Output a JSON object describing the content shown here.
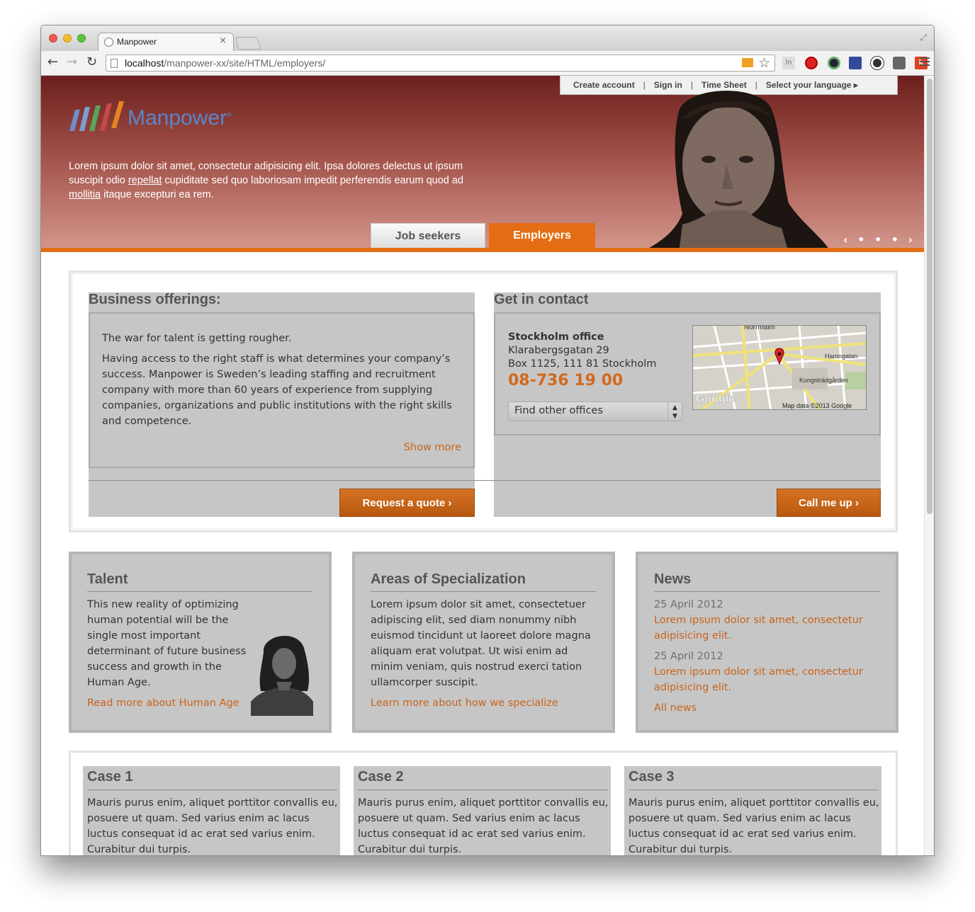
{
  "browser": {
    "tab_title": "Manpower",
    "tab_close": "×",
    "url_host": "localhost",
    "url_path": "/manpower-xx/site/HTML/employers/",
    "extension_k": "k",
    "extension_in": "In",
    "colors": {
      "close": "#ee5a53",
      "minimize": "#f3bb2e",
      "maximize": "#5fc23e"
    }
  },
  "header": {
    "top_nav": [
      "Create account",
      "Sign in",
      "Time Sheet",
      "Select your language ▸"
    ],
    "logo_text": "Manpower",
    "logo_mark": "®",
    "intro_before_link1": "Lorem ipsum dolor sit amet, consectetur adipisicing elit. Ipsa dolores delectus ut ipsum suscipit odio ",
    "intro_link1": "repellat",
    "intro_after_link1": " cupiditate sed quo laboriosam impedit perferendis earum quod ad ",
    "intro_link2": "mollitia",
    "intro_after_link2": " itaque excepturi ea rem.",
    "tabs": {
      "job_seekers": "Job seekers",
      "employers": "Employers"
    },
    "carousel": "‹ • • • ›",
    "colors": {
      "accent": "#e46d14",
      "hero_top": "#6c1f1d",
      "hero_bottom": "#d3958a"
    }
  },
  "business": {
    "title": "Business offerings:",
    "lead": "The war for talent is getting rougher.",
    "body": "Having access to the right staff is what determines your company’s success. Manpower is Sweden’s leading staffing and recruitment company with more than 60 years of experience from supplying companies, organizations and public institutions with the right skills and competence.",
    "show_more": "Show more",
    "button": "Request a quote ›"
  },
  "contact": {
    "title": "Get in contact",
    "office": "Stockholm office",
    "street": "Klarabergsgatan 29",
    "box": "Box 1125, 111 81 Stockholm",
    "phone": "08-736 19 00",
    "select_value": "Find other offices",
    "button": "Call me up ›",
    "map": {
      "label_top": "Norrmalm",
      "label_street": "Hamngatan",
      "label_park": "Kungsträdgården",
      "brand": "Google",
      "credit": "Map data ©2013 Google"
    }
  },
  "talent": {
    "title": "Talent",
    "body": "This new reality of optimizing human potential will be the single most important determinant of future business success and growth in the Human Age.",
    "link": "Read more about Human Age"
  },
  "areas": {
    "title": "Areas of Specialization",
    "body": "Lorem ipsum dolor sit amet, consectetuer adipiscing elit, sed diam nonummy nibh euismod tincidunt ut laoreet dolore magna aliquam erat volutpat. Ut wisi enim ad minim veniam, quis nostrud exerci tation ullamcorper suscipit.",
    "link": "Learn more about how we specialize"
  },
  "news": {
    "title": "News",
    "items": [
      {
        "date": "25 April 2012",
        "headline": "Lorem ipsum dolor sit amet, consectetur adipisicing elit."
      },
      {
        "date": "25 April 2012",
        "headline": "Lorem ipsum dolor sit amet, consectetur adipisicing elit."
      }
    ],
    "all_link": "All news"
  },
  "cases": [
    {
      "title": "Case 1",
      "body": "Mauris purus enim, aliquet porttitor convallis eu, posuere ut quam. Sed varius enim ac lacus luctus consequat id ac erat sed varius enim. Curabitur dui turpis."
    },
    {
      "title": "Case 2",
      "body": "Mauris purus enim, aliquet porttitor convallis eu, posuere ut quam. Sed varius enim ac lacus luctus consequat id ac erat sed varius enim. Curabitur dui turpis."
    },
    {
      "title": "Case 3",
      "body": "Mauris purus enim, aliquet porttitor convallis eu, posuere ut quam. Sed varius enim ac lacus luctus consequat id ac erat sed varius enim. Curabitur dui turpis."
    }
  ]
}
